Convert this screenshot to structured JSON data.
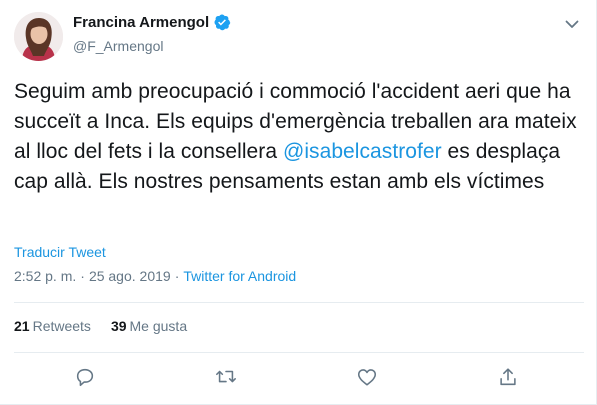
{
  "author": {
    "display_name": "Francina Armengol",
    "handle": "@F_Armengol",
    "verified": true
  },
  "tweet": {
    "text_before": "Seguim amb preocupació i commoció l'accident aeri que ha succeït a Inca. Els equips d'emergència treballen ara mateix al lloc del fets i la consellera ",
    "mention": "@isabelcastrofer",
    "text_after": " es desplaça cap allà. Els nostres pensaments estan amb els víctimes"
  },
  "translate_label": "Traducir Tweet",
  "meta": {
    "time": "2:52 p. m.",
    "separator": "·",
    "date": "25 ago. 2019",
    "separator2": "·",
    "source": "Twitter for Android"
  },
  "stats": {
    "retweets_count": "21",
    "retweets_label": "Retweets",
    "likes_count": "39",
    "likes_label": "Me gusta"
  },
  "icons": {
    "verified": "verified-badge-icon",
    "caret": "chevron-down-icon",
    "reply": "reply-icon",
    "retweet": "retweet-icon",
    "like": "heart-icon",
    "share": "share-icon"
  },
  "colors": {
    "accent": "#1b95e0",
    "text": "#14171a",
    "muted": "#657786"
  }
}
